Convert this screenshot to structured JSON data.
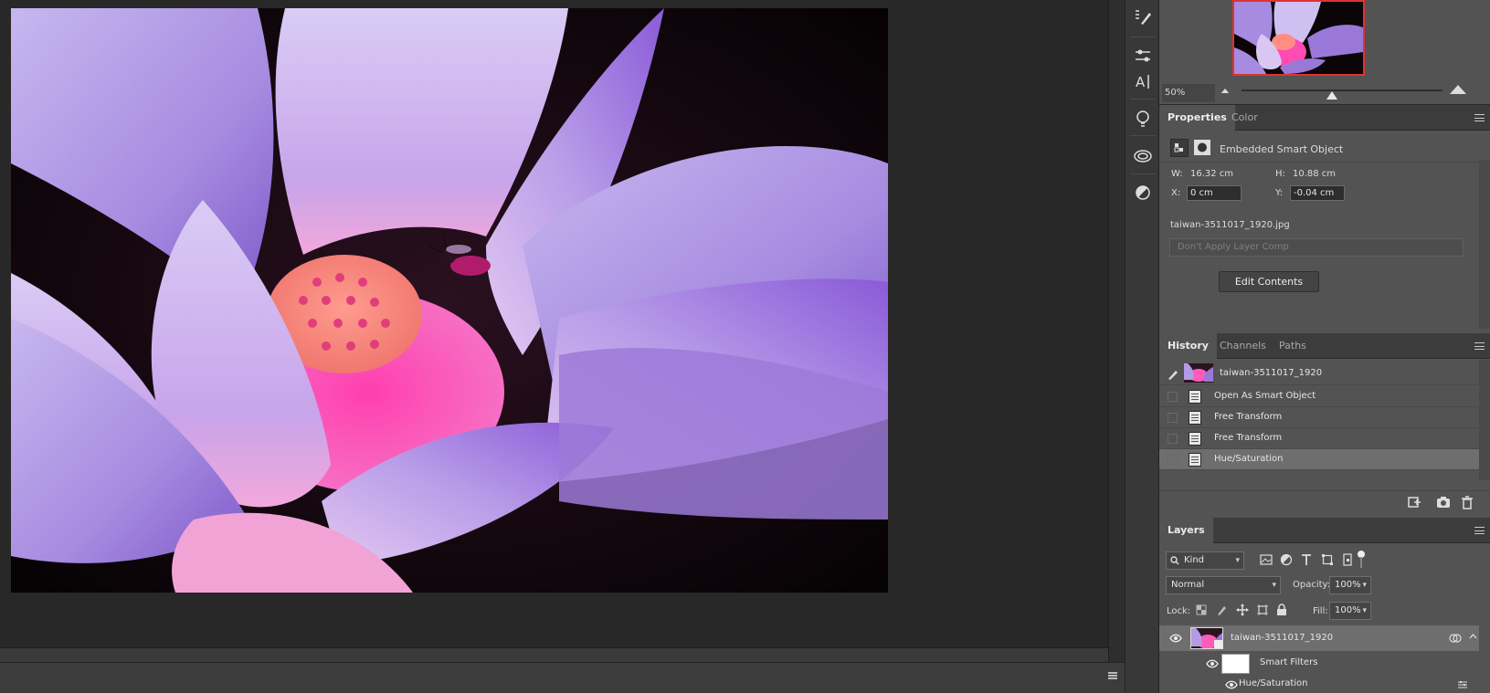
{
  "document": {
    "image_alt": "Purple lotus flower with pink seed pod and bee"
  },
  "navigator": {
    "zoom": "50%",
    "zoom_slider_value": 0.45
  },
  "properties": {
    "tabs": [
      "Properties",
      "Color"
    ],
    "active_tab": "Properties",
    "kind_label": "Embedded Smart Object",
    "w_label": "W:",
    "w_value": "16.32 cm",
    "h_label": "H:",
    "h_value": "10.88 cm",
    "x_label": "X:",
    "x_value": "0 cm",
    "y_label": "Y:",
    "y_value": "-0.04 cm",
    "filename": "taiwan-3511017_1920.jpg",
    "layer_comp": "Don't Apply Layer Comp",
    "edit_button": "Edit Contents"
  },
  "history": {
    "tabs": [
      "History",
      "Channels",
      "Paths"
    ],
    "active_tab": "History",
    "snapshot_label": "taiwan-3511017_1920",
    "states": [
      {
        "label": "Open As Smart Object",
        "selected": false
      },
      {
        "label": "Free Transform",
        "selected": false
      },
      {
        "label": "Free Transform",
        "selected": false
      },
      {
        "label": "Hue/Saturation",
        "selected": true
      }
    ]
  },
  "layers": {
    "tab": "Layers",
    "filter_kind": "Kind",
    "blend_mode": "Normal",
    "opacity_label": "Opacity:",
    "opacity_value": "100%",
    "lock_label": "Lock:",
    "fill_label": "Fill:",
    "fill_value": "100%",
    "items": [
      {
        "name": "taiwan-3511017_1920",
        "type": "smart-object"
      },
      {
        "name": "Smart Filters",
        "type": "filter-mask"
      },
      {
        "name": "Hue/Saturation",
        "type": "smart-filter"
      }
    ]
  },
  "colors": {
    "app_bg": "#282828",
    "panel_bg": "#535353",
    "tabbar_bg": "#3c3c3c",
    "selection": "#6e6e6e",
    "nav_frame": "#e0322f"
  }
}
